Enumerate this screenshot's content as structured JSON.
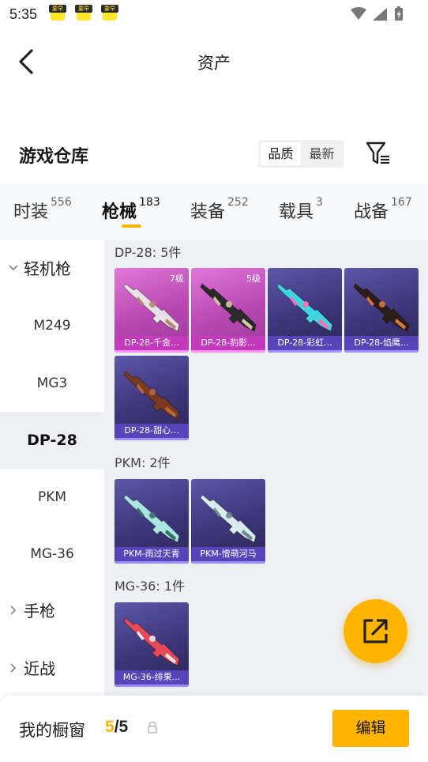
{
  "status_bar": {
    "time": "5:35",
    "notif_badge": "要早"
  },
  "header": {
    "title": "资产"
  },
  "warehouse": {
    "title": "游戏仓库",
    "sort_quality": "品质",
    "sort_latest": "最新"
  },
  "tabs": [
    {
      "label": "时装",
      "count": "556"
    },
    {
      "label": "枪械",
      "count": "183"
    },
    {
      "label": "装备",
      "count": "252"
    },
    {
      "label": "载具",
      "count": "3"
    },
    {
      "label": "战备",
      "count": "167"
    }
  ],
  "sidebar": {
    "group_lmg": "轻机枪",
    "items": [
      "M249",
      "MG3",
      "DP-28",
      "PKM",
      "MG-36"
    ],
    "group_pistol": "手枪",
    "group_melee": "近战"
  },
  "groups": [
    {
      "title": "DP-28: 5件",
      "cards": [
        {
          "name": "DP-28-千金...",
          "level": "7级",
          "rarity": "pink",
          "body": "#e9e0ea",
          "accent": "#b48b6a"
        },
        {
          "name": "DP-28-豹影...",
          "level": "5级",
          "rarity": "pink",
          "body": "#2a2a2a",
          "accent": "#d7c7a2"
        },
        {
          "name": "DP-28-彩虹...",
          "level": "",
          "rarity": "purple",
          "body": "#3fd6e2",
          "accent": "#ff6fb1"
        },
        {
          "name": "DP-28-焰鹰...",
          "level": "",
          "rarity": "purple",
          "body": "#2c1d19",
          "accent": "#d9773a"
        },
        {
          "name": "DP-28-甜心...",
          "level": "",
          "rarity": "purple",
          "body": "#7a3a22",
          "accent": "#b86a3c"
        }
      ]
    },
    {
      "title": "PKM: 2件",
      "cards": [
        {
          "name": "PKM-雨过天青",
          "level": "",
          "rarity": "purple",
          "body": "#a9e6df",
          "accent": "#3f6e6a"
        },
        {
          "name": "PKM-憎萌河马",
          "level": "",
          "rarity": "purple",
          "body": "#d9ecec",
          "accent": "#6d8a8e"
        }
      ]
    },
    {
      "title": "MG-36: 1件",
      "cards": [
        {
          "name": "MG-36-绯果...",
          "level": "",
          "rarity": "purple",
          "body": "#e64a5a",
          "accent": "#f1e4e6"
        }
      ]
    }
  ],
  "bottom": {
    "label": "我的橱窗",
    "current": "5",
    "separator": "/",
    "total": "5",
    "edit": "编辑"
  },
  "colors": {
    "accent": "#ffb400",
    "pink_rarity": "#c43abe",
    "purple_rarity": "#5a46be"
  }
}
